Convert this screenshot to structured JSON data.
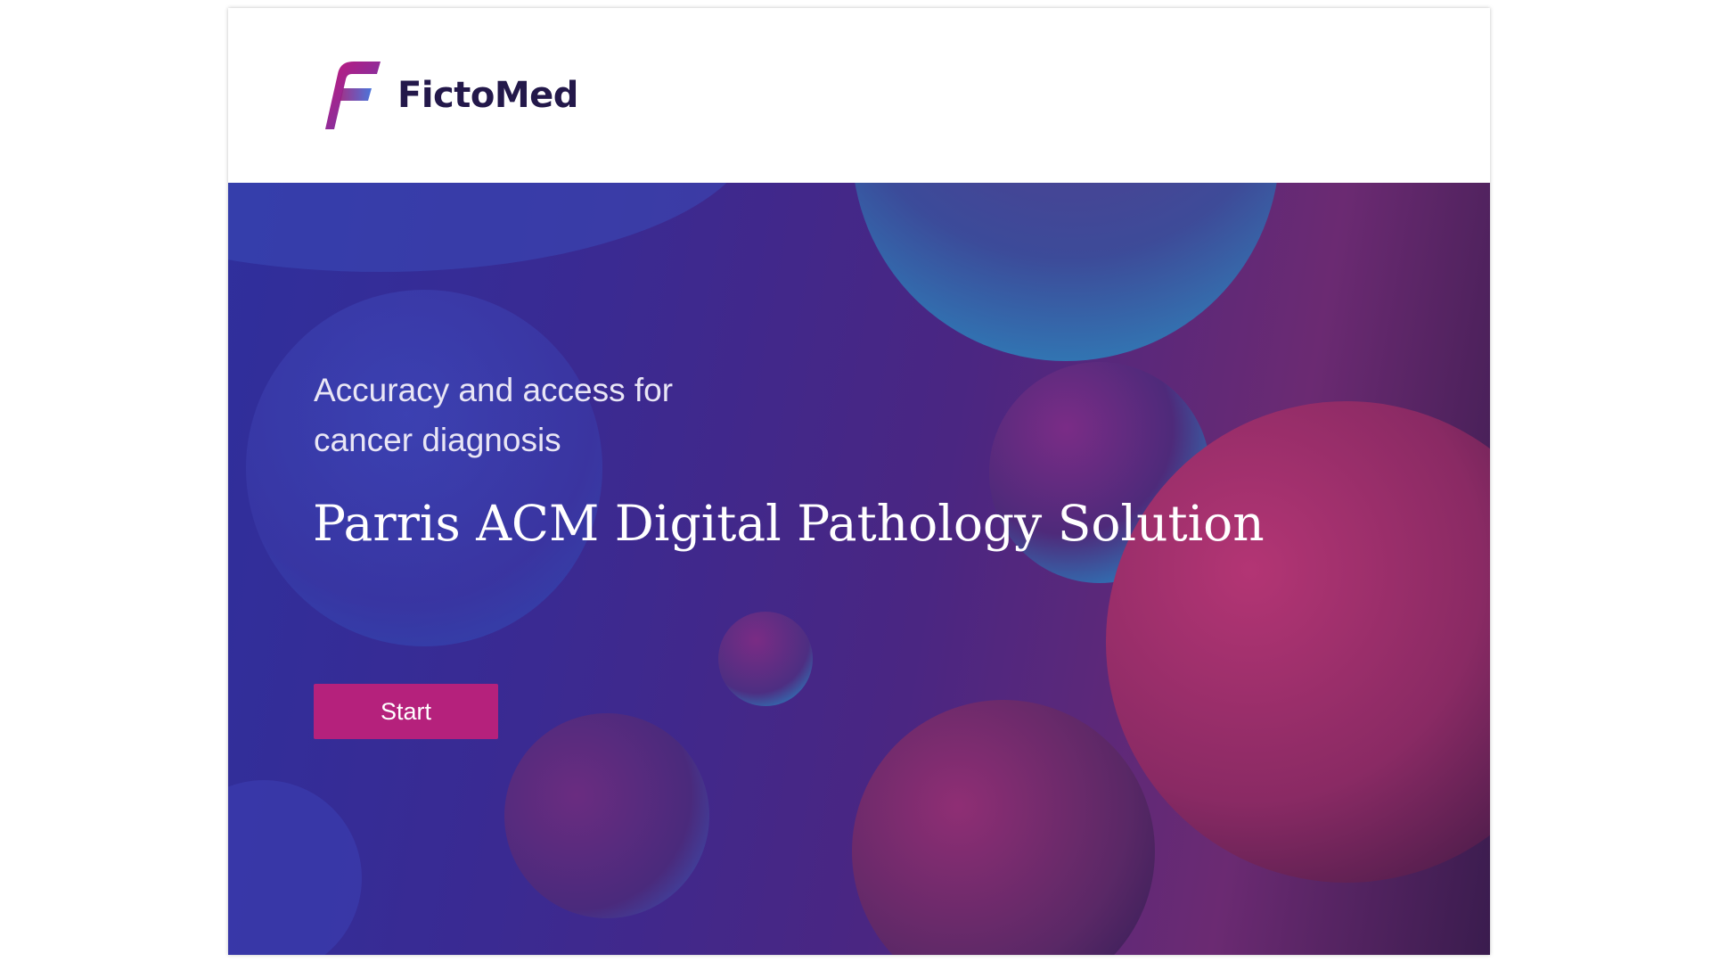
{
  "brand": {
    "name": "FictoMed",
    "logo_icon": "f-letter-logo-icon",
    "logo_colors": [
      "#c2177c",
      "#7a3fb8",
      "#3d5fd6"
    ]
  },
  "hero": {
    "tagline_line1": "Accuracy and access for",
    "tagline_line2": "cancer diagnosis",
    "title": "Parris ACM Digital Pathology Solution",
    "start_label": "Start",
    "accent_color": "#b5217c"
  }
}
